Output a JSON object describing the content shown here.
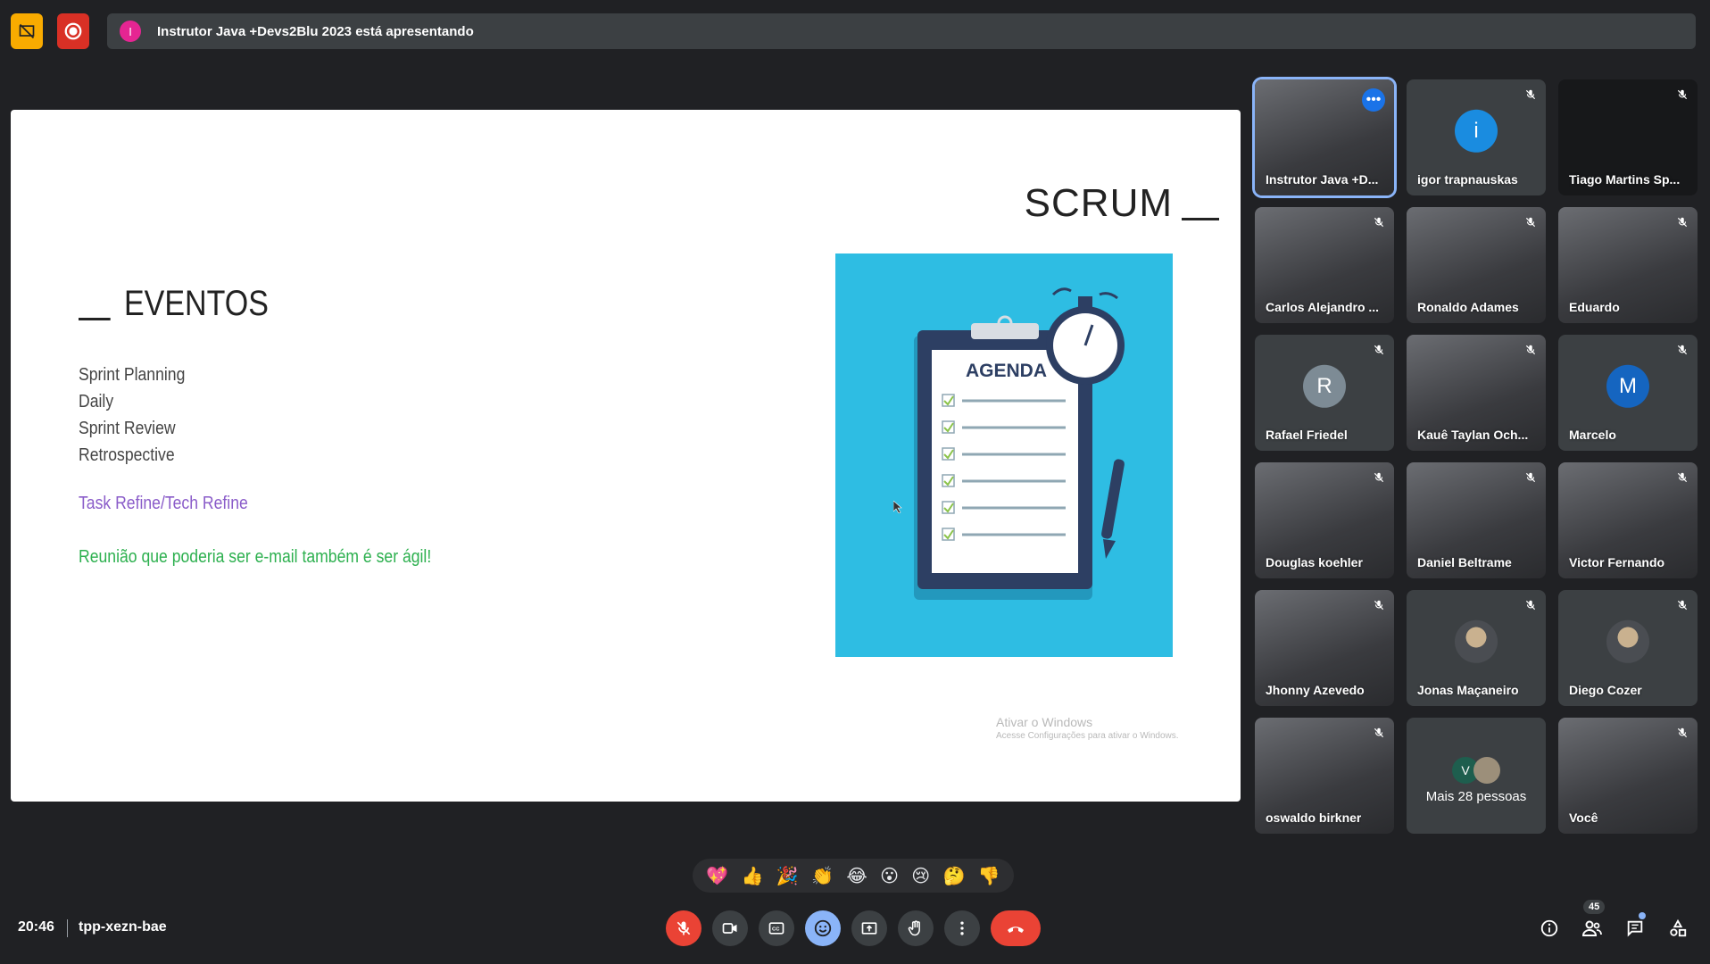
{
  "top": {
    "presenter_initial": "I",
    "presenting_text": "Instrutor Java +Devs2Blu 2023 está apresentando"
  },
  "slide": {
    "logo": "SCRUM",
    "heading": "EVENTOS",
    "events": [
      "Sprint Planning",
      "Daily",
      "Sprint Review",
      "Retrospective"
    ],
    "task_refine": "Task Refine/Tech Refine",
    "reuniao": "Reunião que poderia ser e-mail também é ser ágil!",
    "agenda_label": "AGENDA",
    "watermark_title": "Ativar o Windows",
    "watermark_sub": "Acesse Configurações para ativar o Windows."
  },
  "participants": [
    {
      "name": "Instrutor Java +D...",
      "type": "video",
      "active": true
    },
    {
      "name": "igor trapnauskas",
      "type": "avatar",
      "initial": "i",
      "color": "#1a8ce0"
    },
    {
      "name": "Tiago Martins Sp...",
      "type": "dark"
    },
    {
      "name": "Carlos Alejandro ...",
      "type": "video"
    },
    {
      "name": "Ronaldo Adames",
      "type": "video"
    },
    {
      "name": "Eduardo",
      "type": "video"
    },
    {
      "name": "Rafael Friedel",
      "type": "avatar",
      "initial": "R",
      "color": "#7d8b95"
    },
    {
      "name": "Kauê Taylan Och...",
      "type": "video"
    },
    {
      "name": "Marcelo",
      "type": "avatar",
      "initial": "M",
      "color": "#1565c0"
    },
    {
      "name": "Douglas koehler",
      "type": "video"
    },
    {
      "name": "Daniel Beltrame",
      "type": "video"
    },
    {
      "name": "Victor Fernando",
      "type": "video"
    },
    {
      "name": "Jhonny Azevedo",
      "type": "video"
    },
    {
      "name": "Jonas Maçaneiro",
      "type": "photo"
    },
    {
      "name": "Diego Cozer",
      "type": "photo"
    },
    {
      "name": "oswaldo birkner",
      "type": "video"
    },
    {
      "name": "Mais 28 pessoas",
      "type": "more",
      "initial": "V"
    },
    {
      "name": "Você",
      "type": "video"
    }
  ],
  "reactions": [
    "💖",
    "👍",
    "🎉",
    "👏",
    "😂",
    "😮",
    "😢",
    "🤔",
    "👎"
  ],
  "meeting": {
    "time": "20:46",
    "code": "tpp-xezn-bae",
    "participant_count": "45"
  },
  "colors": {
    "background": "#202124",
    "tile": "#3c4043",
    "end_call": "#ea4335",
    "agenda_bg": "#2ebde3"
  }
}
